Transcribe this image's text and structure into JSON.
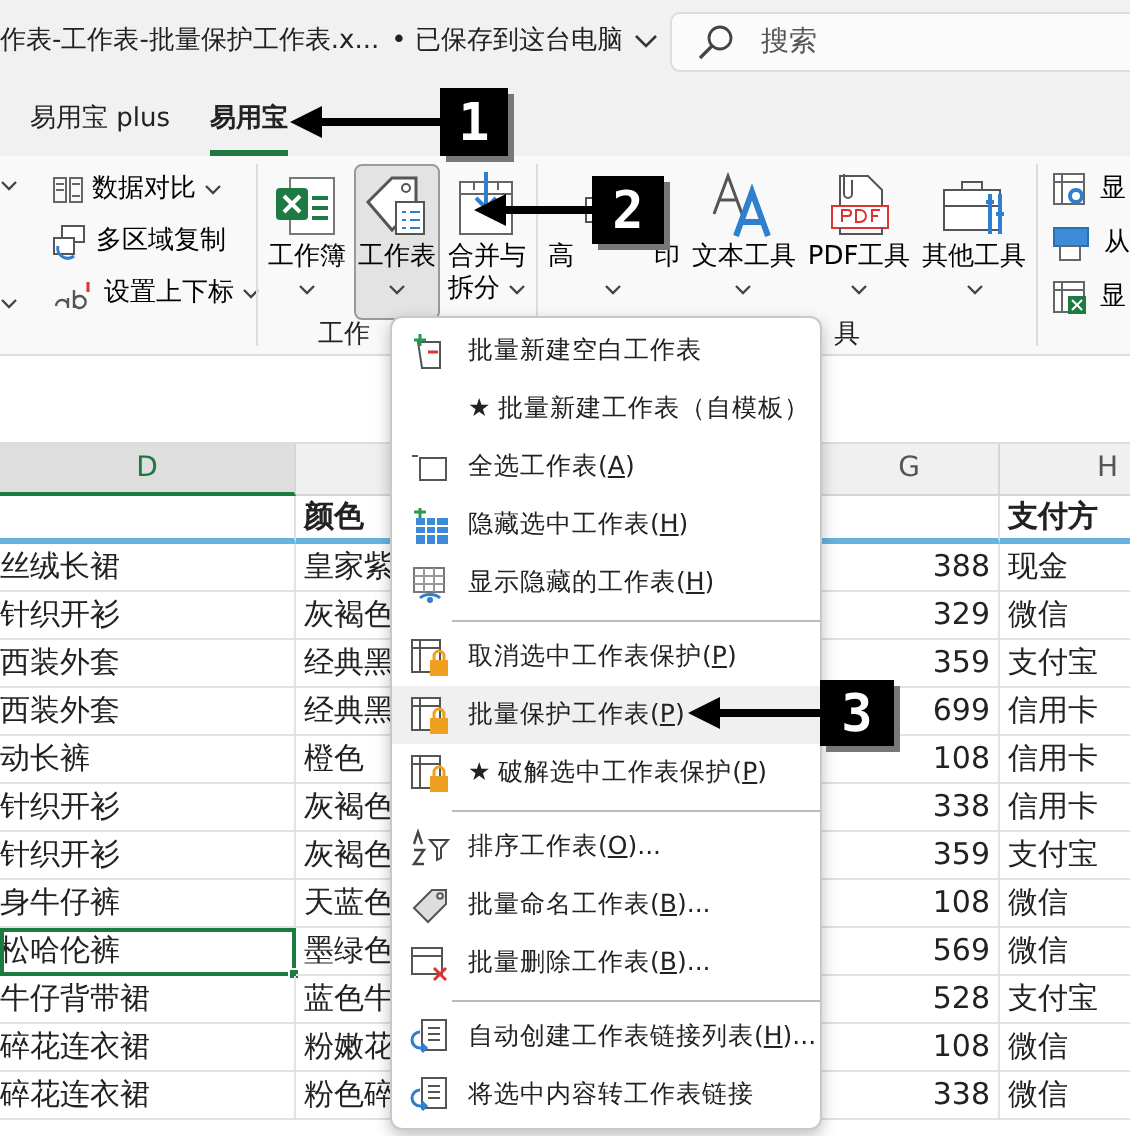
{
  "title_bar": {
    "filename": "作表-工作表-批量保护工作表.x...",
    "save_status": "• 已保存到这台电脑",
    "search": {
      "placeholder": "搜索"
    }
  },
  "ribbon_tabs": [
    {
      "label": "易用宝 plus",
      "selected": false
    },
    {
      "label": "易用宝",
      "selected": true
    }
  ],
  "ribbon": {
    "small_buttons": [
      {
        "label": "数据对比",
        "dropdown": true
      },
      {
        "label": "多区域复制",
        "dropdown": false
      },
      {
        "label": "设置上下标",
        "dropdown": true
      }
    ],
    "groups": [
      {
        "label": "工作",
        "buttons": [
          {
            "label_lines": [
              "工作簿"
            ],
            "dropdown": true,
            "pressed": false
          },
          {
            "label_lines": [
              "工作表"
            ],
            "dropdown": true,
            "pressed": true
          },
          {
            "label_lines": [
              "合并与",
              "拆分"
            ],
            "dropdown": true,
            "pressed": false
          }
        ]
      },
      {
        "label": "具",
        "buttons": [
          {
            "label_start": "高",
            "label_end": "印",
            "dropdown": true,
            "pressed": false
          },
          {
            "label_lines": [
              "文本工具"
            ],
            "dropdown": true,
            "pressed": false
          },
          {
            "label_lines": [
              "PDF工具"
            ],
            "dropdown": true,
            "pressed": false
          },
          {
            "label_lines": [
              "其他工具"
            ],
            "dropdown": true,
            "pressed": false
          }
        ]
      }
    ],
    "right_column": [
      {
        "label": "显"
      },
      {
        "label": "从"
      },
      {
        "label": "显"
      }
    ]
  },
  "sheet": {
    "columns": [
      {
        "letter": "D",
        "selected": true
      },
      {
        "header": "颜色"
      },
      {
        "letter": "G",
        "selected": false
      },
      {
        "letter": "H",
        "selected": false,
        "header": "支付方"
      }
    ],
    "rows": [
      {
        "cells": [
          "丝绒长裙",
          "皇家紫",
          "388",
          "现金"
        ],
        "selected": false
      },
      {
        "cells": [
          "针织开衫",
          "灰褐色",
          "329",
          "微信"
        ],
        "selected": false
      },
      {
        "cells": [
          "西装外套",
          "经典黑",
          "359",
          "支付宝"
        ],
        "selected": false
      },
      {
        "cells": [
          "西装外套",
          "经典黑",
          "699",
          "信用卡"
        ],
        "selected": false
      },
      {
        "cells": [
          "动长裤",
          "橙色",
          "108",
          "信用卡"
        ],
        "selected": false
      },
      {
        "cells": [
          "针织开衫",
          "灰褐色",
          "338",
          "信用卡"
        ],
        "selected": false
      },
      {
        "cells": [
          "针织开衫",
          "灰褐色",
          "359",
          "支付宝"
        ],
        "selected": false
      },
      {
        "cells": [
          "身牛仔裤",
          "天蓝色",
          "108",
          "微信"
        ],
        "selected": false
      },
      {
        "cells": [
          "松哈伦裤",
          "墨绿色",
          "569",
          "微信"
        ],
        "selected": true
      },
      {
        "cells": [
          "牛仔背带裙",
          "蓝色牛",
          "528",
          "支付宝"
        ],
        "selected": false
      },
      {
        "cells": [
          "碎花连衣裙",
          "粉嫩花",
          "108",
          "微信"
        ],
        "selected": false
      },
      {
        "cells": [
          "碎花连衣裙",
          "粉色碎",
          "338",
          "微信"
        ],
        "selected": false
      }
    ]
  },
  "menu": [
    {
      "kind": "item",
      "text": "批量新建空白工作表",
      "highlighted": false
    },
    {
      "kind": "item",
      "text": "★ 批量新建工作表（自模板）",
      "highlighted": false
    },
    {
      "kind": "item",
      "text": "全选工作表(",
      "key": "A",
      "after": ")",
      "highlighted": false
    },
    {
      "kind": "item",
      "text": "隐藏选中工作表(",
      "key": "H",
      "after": ")",
      "highlighted": false
    },
    {
      "kind": "item",
      "text": "显示隐藏的工作表(",
      "key": "H",
      "after": ")",
      "highlighted": false
    },
    {
      "kind": "separator"
    },
    {
      "kind": "item",
      "text": "取消选中工作表保护(",
      "key": "P",
      "after": ")",
      "highlighted": false
    },
    {
      "kind": "item",
      "text": "批量保护工作表(",
      "key": "P",
      "after": ")",
      "highlighted": true
    },
    {
      "kind": "item",
      "text": "★ 破解选中工作表保护(",
      "key": "P",
      "after": ")",
      "highlighted": false
    },
    {
      "kind": "separator"
    },
    {
      "kind": "item",
      "text": "排序工作表(",
      "key": "O",
      "after": ")...",
      "highlighted": false
    },
    {
      "kind": "item",
      "text": "批量命名工作表(",
      "key": "B",
      "after": ")...",
      "highlighted": false
    },
    {
      "kind": "item",
      "text": "批量删除工作表(",
      "key": "B",
      "after": ")...",
      "highlighted": false
    },
    {
      "kind": "separator"
    },
    {
      "kind": "item",
      "text": "自动创建工作表链接列表(",
      "key": "H",
      "after": ")...",
      "highlighted": false
    },
    {
      "kind": "item",
      "text": "将选中内容转工作表链接",
      "highlighted": false
    }
  ],
  "callouts": [
    {
      "label": "1"
    },
    {
      "label": "2"
    },
    {
      "label": "3"
    }
  ]
}
